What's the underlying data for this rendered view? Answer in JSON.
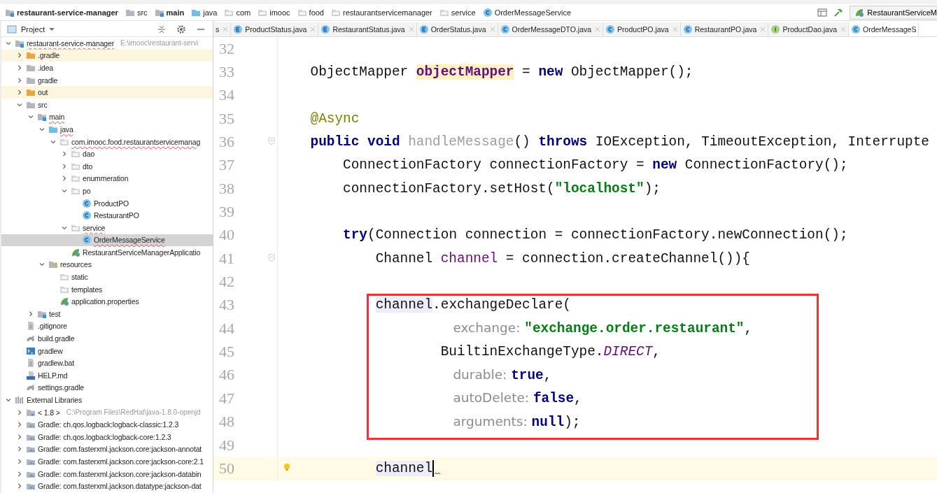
{
  "breadcrumbs": [
    {
      "label": "restaurant-service-manager",
      "kind": "module",
      "bold": true
    },
    {
      "label": "src",
      "kind": "folder",
      "bold": false
    },
    {
      "label": "main",
      "kind": "module",
      "bold": true
    },
    {
      "label": "java",
      "kind": "folder-blue",
      "bold": false
    },
    {
      "label": "com",
      "kind": "package",
      "bold": false
    },
    {
      "label": "imooc",
      "kind": "package",
      "bold": false
    },
    {
      "label": "food",
      "kind": "package",
      "bold": false
    },
    {
      "label": "restaurantservicemanager",
      "kind": "package",
      "bold": false
    },
    {
      "label": "service",
      "kind": "package",
      "bold": false
    },
    {
      "label": "OrderMessageService",
      "kind": "class",
      "bold": false
    }
  ],
  "run_config": {
    "label": "RestaurantServiceM"
  },
  "project_panel": {
    "title": "Project",
    "tree": [
      {
        "label": "restaurant-service-manager",
        "note": "E:\\imooc\\restaurant-servi",
        "kind": "module",
        "expanded": true,
        "selected": false,
        "flagged": true,
        "children": [
          {
            "label": ".gradle",
            "kind": "folder-orange",
            "expanded": false,
            "selected": false,
            "ignored": true
          },
          {
            "label": ".idea",
            "kind": "folder",
            "expanded": false,
            "selected": false
          },
          {
            "label": "gradle",
            "kind": "folder",
            "expanded": false,
            "selected": false
          },
          {
            "label": "out",
            "kind": "folder-orange",
            "expanded": false,
            "selected": false,
            "ignored": true
          },
          {
            "label": "src",
            "kind": "folder",
            "expanded": true,
            "selected": false,
            "children": [
              {
                "label": "main",
                "kind": "module",
                "expanded": true,
                "selected": false,
                "flagged": true,
                "children": [
                  {
                    "label": "java",
                    "kind": "folder-blue",
                    "expanded": true,
                    "selected": false,
                    "flagged": true,
                    "children": [
                      {
                        "label": "com.imooc.food.restaurantservicemanag",
                        "kind": "package",
                        "expanded": true,
                        "selected": false,
                        "flagged": true,
                        "children": [
                          {
                            "label": "dao",
                            "kind": "package",
                            "expanded": false,
                            "selected": false
                          },
                          {
                            "label": "dto",
                            "kind": "package",
                            "expanded": false,
                            "selected": false
                          },
                          {
                            "label": "enummeration",
                            "kind": "package",
                            "expanded": false,
                            "selected": false
                          },
                          {
                            "label": "po",
                            "kind": "package",
                            "expanded": true,
                            "selected": false,
                            "children": [
                              {
                                "label": "ProductPO",
                                "kind": "class",
                                "selected": false
                              },
                              {
                                "label": "RestaurantPO",
                                "kind": "class",
                                "selected": false
                              }
                            ]
                          },
                          {
                            "label": "service",
                            "kind": "package",
                            "expanded": true,
                            "selected": false,
                            "flagged": true,
                            "children": [
                              {
                                "label": "OrderMessageService",
                                "kind": "class",
                                "selected": true,
                                "flagged": true
                              }
                            ]
                          },
                          {
                            "label": "RestaurantServiceManagerApplicatio",
                            "kind": "spring",
                            "selected": false
                          }
                        ]
                      }
                    ]
                  },
                  {
                    "label": "resources",
                    "kind": "resources",
                    "expanded": true,
                    "selected": false,
                    "children": [
                      {
                        "label": "static",
                        "kind": "package",
                        "selected": false
                      },
                      {
                        "label": "templates",
                        "kind": "package",
                        "selected": false
                      },
                      {
                        "label": "application.properties",
                        "kind": "spring",
                        "selected": false
                      }
                    ]
                  }
                ]
              },
              {
                "label": "test",
                "kind": "module",
                "expanded": false,
                "selected": false
              }
            ]
          },
          {
            "label": ".gitignore",
            "kind": "file",
            "selected": false
          },
          {
            "label": "build.gradle",
            "kind": "gradle",
            "selected": false
          },
          {
            "label": "gradlew",
            "kind": "terminal",
            "selected": false
          },
          {
            "label": "gradlew.bat",
            "kind": "file",
            "selected": false
          },
          {
            "label": "HELP.md",
            "kind": "markdown",
            "selected": false
          },
          {
            "label": "settings.gradle",
            "kind": "gradle",
            "selected": false
          }
        ]
      },
      {
        "label": "External Libraries",
        "kind": "libraries",
        "expanded": true,
        "selected": false,
        "children": [
          {
            "label": "< 1.8 >",
            "note": "C:\\Program Files\\RedHat\\java-1.8.0-openjd",
            "kind": "jdk",
            "expanded": false,
            "selected": false
          },
          {
            "label": "Gradle: ch.qos.logback:logback-classic:1.2.3",
            "kind": "library",
            "expanded": false,
            "selected": false
          },
          {
            "label": "Gradle: ch.qos.logback:logback-core:1.2.3",
            "kind": "library",
            "expanded": false,
            "selected": false
          },
          {
            "label": "Gradle: com.fasterxml.jackson.core:jackson-annotat",
            "kind": "library",
            "expanded": false,
            "selected": false
          },
          {
            "label": "Gradle: com.fasterxml.jackson.core:jackson-core:2.1",
            "kind": "library",
            "expanded": false,
            "selected": false
          },
          {
            "label": "Gradle: com.fasterxml.jackson.core:jackson-databin",
            "kind": "library",
            "expanded": false,
            "selected": false
          },
          {
            "label": "Gradle: com.fasterxml.jackson.datatype:jackson-dat",
            "kind": "library",
            "expanded": false,
            "selected": false
          }
        ]
      }
    ]
  },
  "tabs": [
    {
      "label": "s",
      "kind": "none",
      "selected": false
    },
    {
      "label": "ProductStatus.java",
      "kind": "enum",
      "selected": false
    },
    {
      "label": "RestaurantStatus.java",
      "kind": "enum",
      "selected": false
    },
    {
      "label": "OrderStatus.java",
      "kind": "enum",
      "selected": false
    },
    {
      "label": "OrderMessageDTO.java",
      "kind": "class",
      "selected": false
    },
    {
      "label": "ProductPO.java",
      "kind": "class",
      "selected": false
    },
    {
      "label": "RestaurantPO.java",
      "kind": "class",
      "selected": false
    },
    {
      "label": "ProductDao.java",
      "kind": "interface",
      "selected": false
    },
    {
      "label": "OrderMessageS",
      "kind": "class",
      "selected": true
    }
  ],
  "editor": {
    "lines": [
      {
        "number": "32",
        "current": false
      },
      {
        "number": "33",
        "current": false,
        "tokens": [
          {
            "text": "    ObjectMapper ",
            "kind": "plain"
          },
          {
            "text": "objectMapper",
            "kind": "field-usage"
          },
          {
            "text": " = ",
            "kind": "plain"
          },
          {
            "text": "new",
            "kind": "keyword"
          },
          {
            "text": " ObjectMapper();",
            "kind": "plain"
          }
        ]
      },
      {
        "number": "34",
        "current": false
      },
      {
        "number": "35",
        "current": false,
        "tokens": [
          {
            "text": "    @Async",
            "kind": "annotation"
          }
        ]
      },
      {
        "number": "36",
        "current": false,
        "fold": true,
        "tokens": [
          {
            "text": "    public void ",
            "kind": "keyword"
          },
          {
            "text": "handleMessage",
            "kind": "unused"
          },
          {
            "text": "() ",
            "kind": "plain"
          },
          {
            "text": "throws ",
            "kind": "keyword"
          },
          {
            "text": "IOException, TimeoutException, Interrupte",
            "kind": "plain"
          }
        ]
      },
      {
        "number": "37",
        "current": false,
        "tokens": [
          {
            "text": "        ConnectionFactory connectionFactory = ",
            "kind": "plain"
          },
          {
            "text": "new",
            "kind": "keyword"
          },
          {
            "text": " ConnectionFactory();",
            "kind": "plain"
          }
        ]
      },
      {
        "number": "38",
        "current": false,
        "tokens": [
          {
            "text": "        connectionFactory.setHost(",
            "kind": "plain"
          },
          {
            "text": "\"localhost\"",
            "kind": "string"
          },
          {
            "text": ");",
            "kind": "plain"
          }
        ]
      },
      {
        "number": "39",
        "current": false
      },
      {
        "number": "40",
        "current": false,
        "tokens": [
          {
            "text": "        try",
            "kind": "keyword"
          },
          {
            "text": "(Connection connection = connectionFactory.newConnection();",
            "kind": "plain"
          }
        ]
      },
      {
        "number": "41",
        "current": false,
        "fold": true,
        "tokens": [
          {
            "text": "            Channel ",
            "kind": "plain"
          },
          {
            "text": "channel",
            "kind": "variable"
          },
          {
            "text": " = connection.createChannel()){",
            "kind": "plain"
          }
        ]
      },
      {
        "number": "42",
        "current": false
      },
      {
        "number": "43",
        "current": false,
        "boxed": true,
        "tokens": [
          {
            "text": "            channel",
            "kind": "var-usage"
          },
          {
            "text": ".exchangeDeclare(",
            "kind": "plain"
          }
        ]
      },
      {
        "number": "44",
        "current": false,
        "boxed": true,
        "tokens": [
          {
            "text": "                     exchange: ",
            "kind": "hint"
          },
          {
            "text": "\"exchange.order.restaurant\"",
            "kind": "string"
          },
          {
            "text": ",",
            "kind": "plain"
          }
        ]
      },
      {
        "number": "45",
        "current": false,
        "boxed": true,
        "tokens": [
          {
            "text": "                    BuiltinExchangeType.",
            "kind": "plain"
          },
          {
            "text": "DIRECT",
            "kind": "static"
          },
          {
            "text": ",",
            "kind": "plain"
          }
        ]
      },
      {
        "number": "46",
        "current": false,
        "boxed": true,
        "tokens": [
          {
            "text": "                     durable: ",
            "kind": "hint"
          },
          {
            "text": "true",
            "kind": "keyword"
          },
          {
            "text": ",",
            "kind": "plain"
          }
        ]
      },
      {
        "number": "47",
        "current": false,
        "boxed": true,
        "tokens": [
          {
            "text": "                     autoDelete: ",
            "kind": "hint"
          },
          {
            "text": "false",
            "kind": "keyword"
          },
          {
            "text": ",",
            "kind": "plain"
          }
        ]
      },
      {
        "number": "48",
        "current": false,
        "boxed": true,
        "tokens": [
          {
            "text": "                     arguments: ",
            "kind": "hint"
          },
          {
            "text": "null",
            "kind": "keyword"
          },
          {
            "text": ");",
            "kind": "plain"
          }
        ]
      },
      {
        "number": "49",
        "current": false
      },
      {
        "number": "50",
        "current": true,
        "bulb": true,
        "caret": true,
        "error": true,
        "tokens": [
          {
            "text": "            channel",
            "kind": "var-usage"
          }
        ]
      }
    ]
  }
}
